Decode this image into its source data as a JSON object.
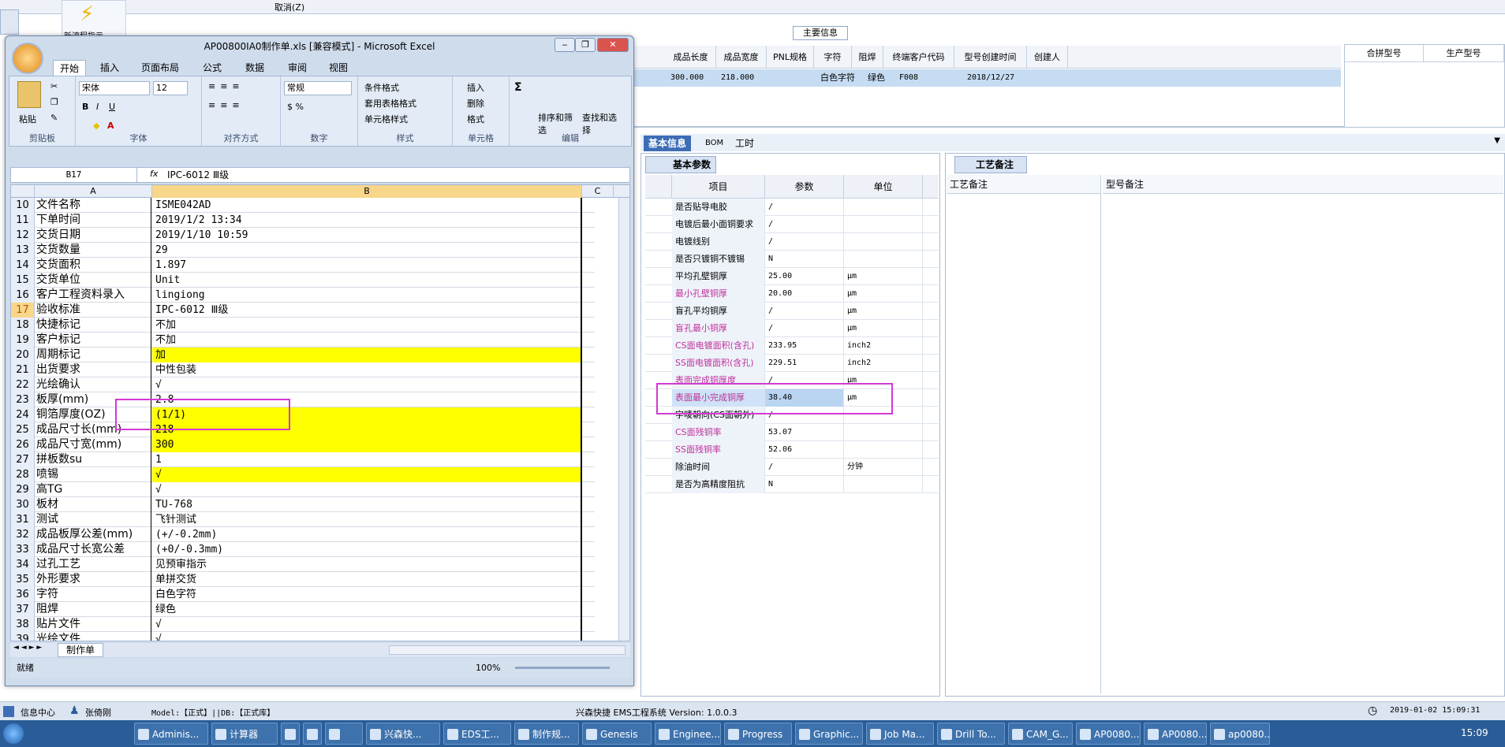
{
  "bg": {
    "menu_items": [
      "取消(Z)"
    ],
    "tool_label": "新流程指示",
    "main_info_title": "主要信息",
    "grid_headers": [
      "成品长度",
      "成品宽度",
      "PNL规格",
      "字符",
      "阻焊",
      "终端客户代码",
      "型号创建时间",
      "创建人"
    ],
    "grid_row": {
      "len": "300.000",
      "wid": "218.000",
      "pnl": "",
      "char": "白色字符",
      "mask": "绿色",
      "cust": "F008",
      "created": "2018/12/27",
      "creator": ""
    },
    "right_headers": [
      "合拼型号",
      "生产型号"
    ],
    "tabs": [
      "基本信息",
      "BOM",
      "工时"
    ],
    "subtab": "基本参数",
    "param_headers": [
      "项目",
      "参数",
      "单位"
    ],
    "params": [
      {
        "name": "是否贴导电胶",
        "val": "/",
        "unit": "",
        "pink": false
      },
      {
        "name": "电镀后最小面铜要求",
        "val": "/",
        "unit": "",
        "pink": false
      },
      {
        "name": "电镀线别",
        "val": "/",
        "unit": "",
        "pink": false
      },
      {
        "name": "是否只镀铜不镀锡",
        "val": "N",
        "unit": "",
        "pink": false
      },
      {
        "name": "平均孔壁铜厚",
        "val": "25.00",
        "unit": "μm",
        "pink": false
      },
      {
        "name": "最小孔壁铜厚",
        "val": "20.00",
        "unit": "μm",
        "pink": true
      },
      {
        "name": "盲孔平均铜厚",
        "val": "/",
        "unit": "μm",
        "pink": false
      },
      {
        "name": "盲孔最小铜厚",
        "val": "/",
        "unit": "μm",
        "pink": true
      },
      {
        "name": "CS面电镀面积(含孔)",
        "val": "233.95",
        "unit": "inch2",
        "pink": true
      },
      {
        "name": "SS面电镀面积(含孔)",
        "val": "229.51",
        "unit": "inch2",
        "pink": true
      },
      {
        "name": "表面完成铜厚度",
        "val": "/",
        "unit": "μm",
        "pink": true
      },
      {
        "name": "表面最小完成铜厚",
        "val": "38.40",
        "unit": "μm",
        "pink": true,
        "sel": true
      },
      {
        "name": "字唛朝向(CS面朝外)",
        "val": "/",
        "unit": "",
        "pink": false
      },
      {
        "name": "CS面残铜率",
        "val": "53.07",
        "unit": "",
        "pink": true
      },
      {
        "name": "SS面残铜率",
        "val": "52.06",
        "unit": "",
        "pink": true
      },
      {
        "name": "除油时间",
        "val": "/",
        "unit": "分钟",
        "pink": false
      },
      {
        "name": "是否为高精度阻抗",
        "val": "N",
        "unit": "",
        "pink": false
      }
    ],
    "right_tab": "工艺备注",
    "right_cols": [
      "工艺备注",
      "型号备注"
    ]
  },
  "status": {
    "info_center": "信息中心",
    "user": "张倚刚",
    "model": "Model:【正式】||DB:【正式库】",
    "system": "兴森快捷 EMS工程系统 Version: 1.0.0.3",
    "datetime": "2019-01-02 15:09:31"
  },
  "taskbar": {
    "buttons": [
      "Adminis...",
      "计算器",
      "",
      "",
      "",
      "兴森快...",
      "EDS工...",
      "制作规...",
      "Genesis",
      "Enginee...",
      "Progress",
      "Graphic...",
      "Job Ma...",
      "Drill To...",
      "CAM_G...",
      "AP0080...",
      "AP0080...",
      "ap0080..."
    ],
    "clock": "15:09"
  },
  "excel": {
    "title": "AP00800IA0制作单.xls [兼容模式] - Microsoft Excel",
    "ribbon_tabs": [
      "开始",
      "插入",
      "页面布局",
      "公式",
      "数据",
      "审阅",
      "视图"
    ],
    "groups": {
      "clipboard": "剪贴板",
      "font": "字体",
      "align": "对齐方式",
      "number": "数字",
      "styles": "样式",
      "cells": "单元格",
      "edit": "编辑"
    },
    "paste": "粘贴",
    "font_name": "宋体",
    "font_size": "12",
    "number_format": "常规",
    "styles_items": [
      "条件格式",
      "套用表格格式",
      "单元格样式"
    ],
    "cells_items": [
      "插入",
      "删除",
      "格式"
    ],
    "edit_items": [
      "排序和筛选",
      "查找和选择"
    ],
    "name_box": "B17",
    "formula": "IPC-6012 Ⅲ级",
    "col_headers": [
      "A",
      "B",
      "C"
    ],
    "rows": [
      {
        "n": "10",
        "a": "文件名称",
        "b": "ISME042AD",
        "y": false
      },
      {
        "n": "11",
        "a": "下单时间",
        "b": "2019/1/2 13:34",
        "y": false
      },
      {
        "n": "12",
        "a": "交货日期",
        "b": "2019/1/10 10:59",
        "y": false
      },
      {
        "n": "13",
        "a": "交货数量",
        "b": "29",
        "y": false
      },
      {
        "n": "14",
        "a": "交货面积",
        "b": "1.897",
        "y": false
      },
      {
        "n": "15",
        "a": "交货单位",
        "b": "Unit",
        "y": false
      },
      {
        "n": "16",
        "a": "客户工程资料录入",
        "b": "lingiong",
        "y": false
      },
      {
        "n": "17",
        "a": "验收标准",
        "b": "IPC-6012 Ⅲ级",
        "y": false,
        "sel": true
      },
      {
        "n": "18",
        "a": "快捷标记",
        "b": "不加",
        "y": false
      },
      {
        "n": "19",
        "a": "客户标记",
        "b": "不加",
        "y": false
      },
      {
        "n": "20",
        "a": "周期标记",
        "b": "加",
        "y": true
      },
      {
        "n": "21",
        "a": "出货要求",
        "b": "中性包装",
        "y": false
      },
      {
        "n": "22",
        "a": "光绘确认",
        "b": "√",
        "y": false
      },
      {
        "n": "23",
        "a": "板厚(mm)",
        "b": "2.8",
        "y": false
      },
      {
        "n": "24",
        "a": "铜箔厚度(OZ)",
        "b": " (1/1)",
        "y": true
      },
      {
        "n": "25",
        "a": "成品尺寸长(mm)",
        "b": "218",
        "y": true
      },
      {
        "n": "26",
        "a": "成品尺寸宽(mm)",
        "b": "300",
        "y": true
      },
      {
        "n": "27",
        "a": "拼板数su",
        "b": "1",
        "y": false
      },
      {
        "n": "28",
        "a": "喷锡",
        "b": "√",
        "y": true
      },
      {
        "n": "29",
        "a": "高TG",
        "b": "√",
        "y": false
      },
      {
        "n": "30",
        "a": "板材",
        "b": "TU-768",
        "y": false
      },
      {
        "n": "31",
        "a": "测试",
        "b": "飞针测试",
        "y": false
      },
      {
        "n": "32",
        "a": "成品板厚公差(mm)",
        "b": "(+/-0.2mm)",
        "y": false
      },
      {
        "n": "33",
        "a": "成品尺寸长宽公差",
        "b": "(+0/-0.3mm)",
        "y": false
      },
      {
        "n": "34",
        "a": "过孔工艺",
        "b": "见预审指示",
        "y": false
      },
      {
        "n": "35",
        "a": "外形要求",
        "b": "单拼交货",
        "y": false
      },
      {
        "n": "36",
        "a": "字符",
        "b": "白色字符",
        "y": false
      },
      {
        "n": "37",
        "a": "阻焊",
        "b": "绿色",
        "y": false
      },
      {
        "n": "38",
        "a": "贴片文件",
        "b": "√",
        "y": false
      },
      {
        "n": "39",
        "a": "光绘文件",
        "b": "√",
        "y": false
      }
    ],
    "sheet_tab": "制作单",
    "status_ready": "就绪",
    "zoom": "100%"
  },
  "colors": {
    "accent": "#3d6db5",
    "highlight": "#ffff00",
    "annotation": "#d23ad2"
  }
}
